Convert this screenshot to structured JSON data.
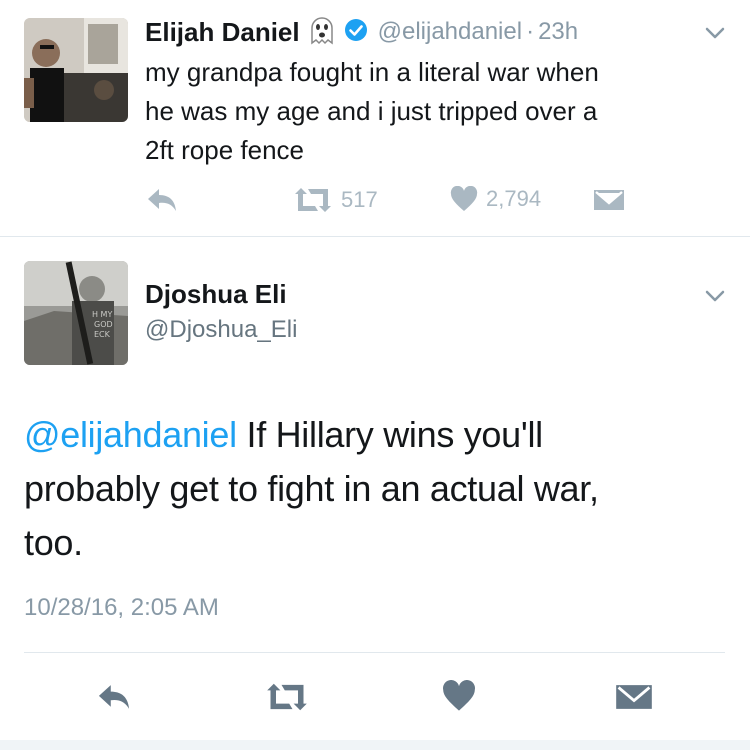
{
  "tweet1": {
    "display_name": "Elijah Daniel",
    "handle": "@elijahdaniel",
    "separator": "·",
    "time": "23h",
    "text_lines": [
      "my grandpa fought in a literal war when",
      "he was my age and i just tripped over a",
      "2ft rope fence"
    ],
    "retweet_count": "517",
    "like_count": "2,794"
  },
  "tweet2": {
    "display_name": "Djoshua Eli",
    "handle": "@Djoshua_Eli",
    "mention": "@elijahdaniel",
    "line1_rest": " If Hillary wins you'll",
    "line2": "probably get to fight in an actual war,",
    "line3": "too.",
    "timestamp": "10/28/16, 2:05 AM"
  },
  "icons": [
    "ghost-emoji",
    "verified-badge-icon",
    "chevron-down-icon",
    "reply-icon",
    "retweet-icon",
    "like-icon",
    "direct-message-icon"
  ],
  "colors": {
    "link_blue": "#1da1f2",
    "icon_gray": "#aab8c2",
    "meta_gray": "#8899a6",
    "text": "#14171a",
    "verified": "#1da1f2"
  }
}
